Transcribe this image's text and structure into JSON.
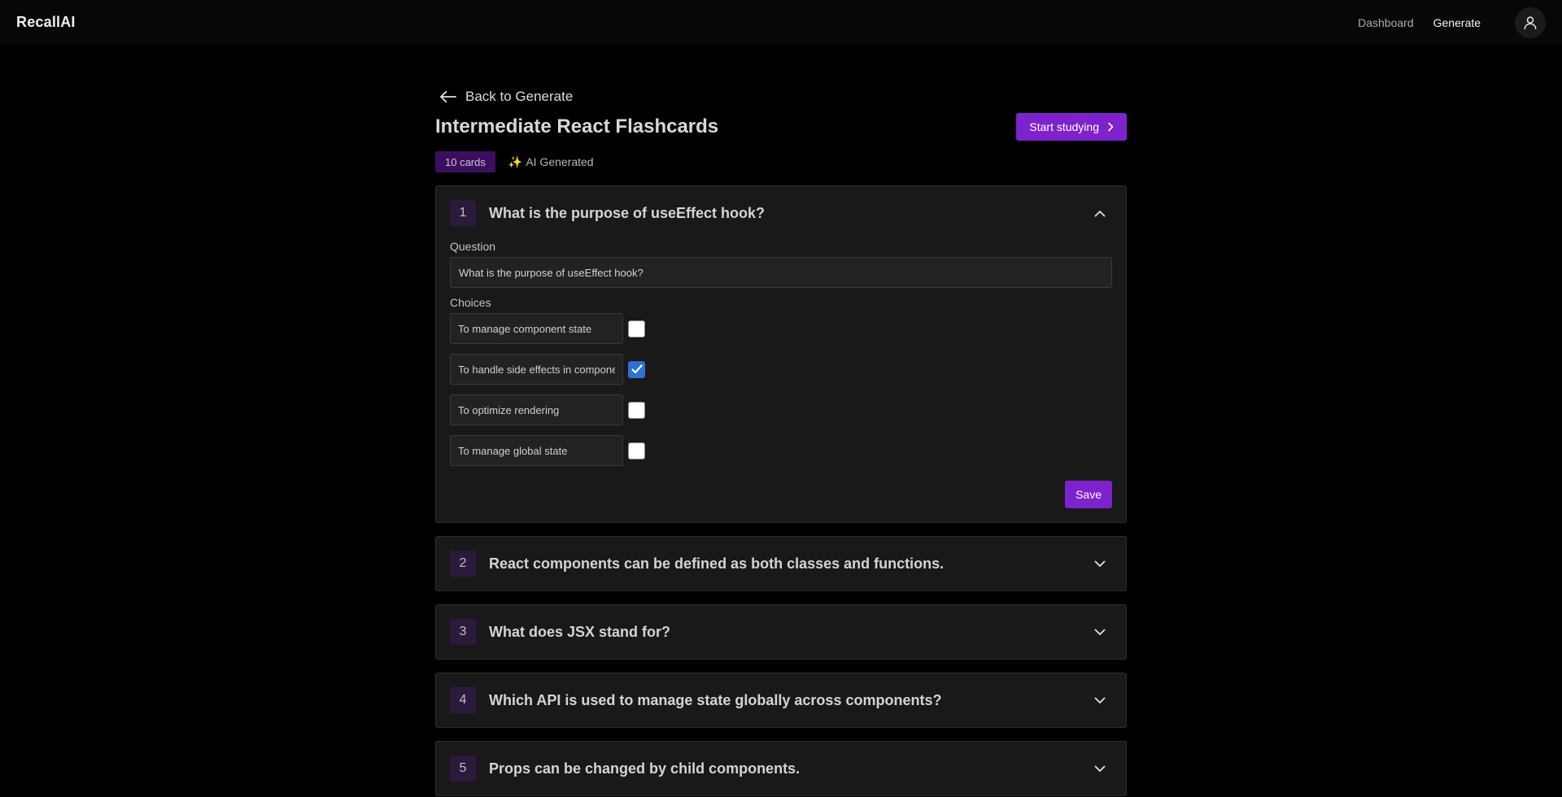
{
  "nav": {
    "brand": "RecallAI",
    "links": [
      {
        "label": "Dashboard",
        "active": false
      },
      {
        "label": "Generate",
        "active": true
      }
    ],
    "avatar_icon": "user-icon"
  },
  "page": {
    "back_label": "Back to Generate",
    "title": "Intermediate React Flashcards",
    "start_button": "Start studying",
    "card_count_badge": "10 cards",
    "ai_sparkle": "✨",
    "ai_label": "AI Generated"
  },
  "cards": [
    {
      "number": "1",
      "title": "What is the purpose of useEffect hook?",
      "expanded": true,
      "question_label": "Question",
      "question_value": "What is the purpose of useEffect hook?",
      "choices_label": "Choices",
      "choices": [
        {
          "text": "To manage component state",
          "checked": false
        },
        {
          "text": "To handle side effects in components",
          "checked": true
        },
        {
          "text": "To optimize rendering",
          "checked": false
        },
        {
          "text": "To manage global state",
          "checked": false
        }
      ],
      "save_label": "Save"
    },
    {
      "number": "2",
      "title": "React components can be defined as both classes and functions.",
      "expanded": false
    },
    {
      "number": "3",
      "title": "What does JSX stand for?",
      "expanded": false
    },
    {
      "number": "4",
      "title": "Which API is used to manage state globally across components?",
      "expanded": false
    },
    {
      "number": "5",
      "title": "Props can be changed by child components.",
      "expanded": false
    }
  ],
  "colors": {
    "accent": "#7e22ce",
    "badge_bg": "#3b0f5e",
    "checkbox_checked": "#2f6fd6"
  }
}
